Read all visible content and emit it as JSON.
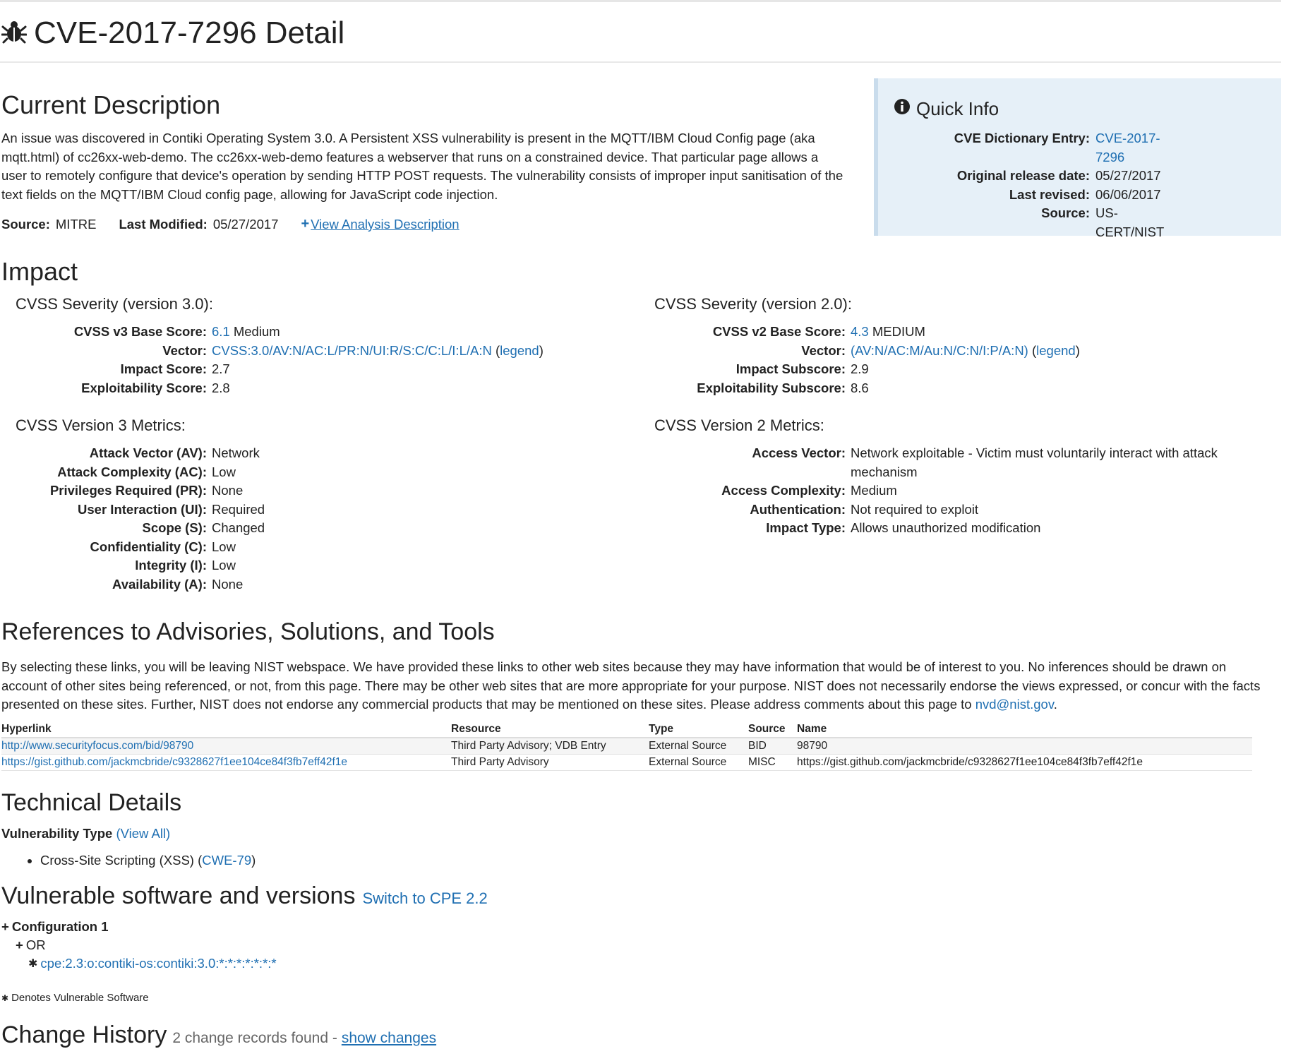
{
  "page": {
    "title": "CVE-2017-7296 Detail"
  },
  "description": {
    "heading": "Current Description",
    "text": "An issue was discovered in Contiki Operating System 3.0. A Persistent XSS vulnerability is present in the MQTT/IBM Cloud Config page (aka mqtt.html) of cc26xx-web-demo. The cc26xx-web-demo features a webserver that runs on a constrained device. That particular page allows a user to remotely configure that device's operation by sending HTTP POST requests. The vulnerability consists of improper input sanitisation of the text fields on the MQTT/IBM Cloud config page, allowing for JavaScript code injection.",
    "source_label": "Source:",
    "source_value": "MITRE",
    "modified_label": "Last Modified:",
    "modified_value": "05/27/2017",
    "view_analysis": "View Analysis Description"
  },
  "quick_info": {
    "heading": "Quick Info",
    "cve_entry_label": "CVE Dictionary Entry:",
    "cve_entry_value": "CVE-2017-7296",
    "release_label": "Original release date:",
    "release_value": "05/27/2017",
    "revised_label": "Last revised:",
    "revised_value": "06/06/2017",
    "source_label": "Source:",
    "source_value": "US-CERT/NIST"
  },
  "impact": {
    "heading": "Impact",
    "v3": {
      "heading": "CVSS Severity (version 3.0):",
      "base_label": "CVSS v3 Base Score:",
      "base_score": "6.1",
      "base_severity": "Medium",
      "vector_label": "Vector:",
      "vector_value": "CVSS:3.0/AV:N/AC:L/PR:N/UI:R/S:C/C:L/I:L/A:N",
      "legend": "legend",
      "impact_label": "Impact Score:",
      "impact_value": "2.7",
      "exploit_label": "Exploitability Score:",
      "exploit_value": "2.8",
      "metrics_heading": "CVSS Version 3 Metrics:",
      "metrics": [
        {
          "k": "Attack Vector (AV):",
          "v": "Network"
        },
        {
          "k": "Attack Complexity (AC):",
          "v": "Low"
        },
        {
          "k": "Privileges Required (PR):",
          "v": "None"
        },
        {
          "k": "User Interaction (UI):",
          "v": "Required"
        },
        {
          "k": "Scope (S):",
          "v": "Changed"
        },
        {
          "k": "Confidentiality (C):",
          "v": "Low"
        },
        {
          "k": "Integrity (I):",
          "v": "Low"
        },
        {
          "k": "Availability (A):",
          "v": "None"
        }
      ]
    },
    "v2": {
      "heading": "CVSS Severity (version 2.0):",
      "base_label": "CVSS v2 Base Score:",
      "base_score": "4.3",
      "base_severity": "MEDIUM",
      "vector_label": "Vector:",
      "vector_value": "(AV:N/AC:M/Au:N/C:N/I:P/A:N)",
      "legend": "legend",
      "impact_label": "Impact Subscore:",
      "impact_value": "2.9",
      "exploit_label": "Exploitability Subscore:",
      "exploit_value": "8.6",
      "metrics_heading": "CVSS Version 2 Metrics:",
      "metrics": [
        {
          "k": "Access Vector:",
          "v": "Network exploitable - Victim must voluntarily interact with attack mechanism"
        },
        {
          "k": "Access Complexity:",
          "v": "Medium"
        },
        {
          "k": "Authentication:",
          "v": "Not required to exploit"
        },
        {
          "k": "Impact Type:",
          "v": "Allows unauthorized modification"
        }
      ]
    }
  },
  "references": {
    "heading": "References to Advisories, Solutions, and Tools",
    "intro": "By selecting these links, you will be leaving NIST webspace. We have provided these links to other web sites because they may have information that would be of interest to you. No inferences should be drawn on account of other sites being referenced, or not, from this page. There may be other web sites that are more appropriate for your purpose. NIST does not necessarily endorse the views expressed, or concur with the facts presented on these sites. Further, NIST does not endorse any commercial products that may be mentioned on these sites. Please address comments about this page to",
    "email": "nvd@nist.gov",
    "columns": [
      "Hyperlink",
      "Resource",
      "Type",
      "Source",
      "Name"
    ],
    "rows": [
      {
        "hyperlink": "http://www.securityfocus.com/bid/98790",
        "resource": "Third Party Advisory; VDB Entry",
        "type": "External Source",
        "source": "BID",
        "name": "98790"
      },
      {
        "hyperlink": "https://gist.github.com/jackmcbride/c9328627f1ee104ce84f3fb7eff42f1e",
        "resource": "Third Party Advisory",
        "type": "External Source",
        "source": "MISC",
        "name": "https://gist.github.com/jackmcbride/c9328627f1ee104ce84f3fb7eff42f1e"
      }
    ]
  },
  "technical": {
    "heading": "Technical Details",
    "vuln_type_label": "Vulnerability Type",
    "view_all": "(View All)",
    "item_text": "Cross-Site Scripting (XSS)",
    "cwe": "CWE-79"
  },
  "software": {
    "heading": "Vulnerable software and versions",
    "switch_cpe": "Switch to CPE 2.2",
    "config_label": "Configuration 1",
    "or_label": "OR",
    "cpe": "cpe:2.3:o:contiki-os:contiki:3.0:*:*:*:*:*:*:*",
    "denotes": "Denotes Vulnerable Software"
  },
  "history": {
    "heading": "Change History",
    "records": "2 change records found -",
    "show_changes": "show changes"
  },
  "colors": {
    "link": "#1f6fb2",
    "quick_bg": "#e6f0f8",
    "quick_border": "#c9dcec"
  }
}
